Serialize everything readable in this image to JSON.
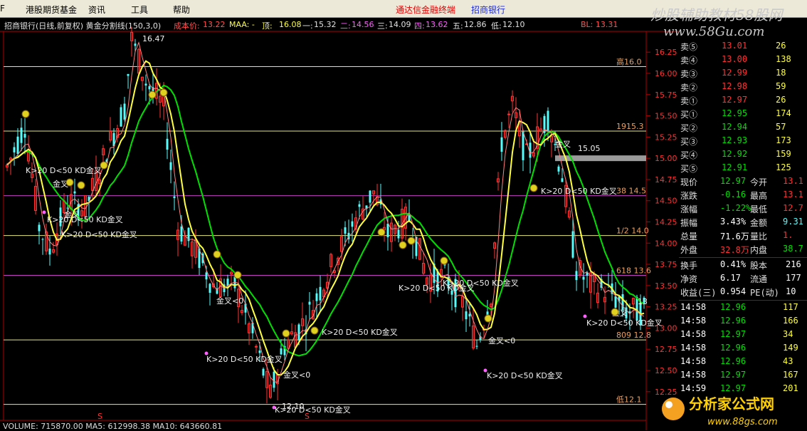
{
  "menu": {
    "items": [
      "F",
      "港股期货基金",
      "资讯",
      "工具",
      "帮助"
    ],
    "promo": "通达信金融终端",
    "stock_name": "招商银行"
  },
  "info": {
    "title": "招商银行(日线,前复权) 黄金分割线(150,3,0)",
    "cost_label": "成本价:",
    "cost_value": "13.22",
    "maa_label": "MAA: -",
    "top_label": "顶:",
    "top_value": "16.08",
    "l1_label": "一:",
    "l1_value": "15.32",
    "l2_label": "二:",
    "l2_value": "14.56",
    "l3_label": "三:",
    "l3_value": "14.09",
    "l4_label": "四:",
    "l4_value": "13.62",
    "l5_label": "五:",
    "l5_value": "12.86",
    "low_label": "低:",
    "low_value": "12.10",
    "bl": "BL: 13.31"
  },
  "watermark": {
    "top_line1": "炒股辅助教材58股网",
    "top_line2": "www.58Gu.com",
    "bottom_line1": "分析家公式网",
    "bottom_line2": "www.88gs.com"
  },
  "price_axis": [
    "16.25",
    "16.00",
    "15.75",
    "15.50",
    "15.25",
    "15.00",
    "14.75",
    "14.50",
    "14.25",
    "14.00",
    "13.75",
    "13.50",
    "13.25",
    "13.00",
    "12.75",
    "12.50",
    "12.25"
  ],
  "fib_labels": [
    "高16.0",
    "1915.3",
    "38 14.5",
    "1/2 14.0",
    "618 13.6",
    "809 12.8",
    "低12.1"
  ],
  "annotations": {
    "peak": "16.47",
    "trough": "12.10",
    "kd": "K>20 D<50 KD金叉",
    "cross": "金叉",
    "cross_lt": "金叉<0",
    "peak2": "15.05",
    "right_13": "13",
    "s1": "S",
    "s2": "S"
  },
  "quote": {
    "sell": [
      {
        "label": "卖⑤",
        "price": "13.01",
        "vol": "26"
      },
      {
        "label": "卖④",
        "price": "13.00",
        "vol": "138"
      },
      {
        "label": "卖③",
        "price": "12.99",
        "vol": "18"
      },
      {
        "label": "卖②",
        "price": "12.98",
        "vol": "59"
      },
      {
        "label": "卖①",
        "price": "12.97",
        "vol": "26"
      }
    ],
    "buy": [
      {
        "label": "买①",
        "price": "12.95",
        "vol": "174"
      },
      {
        "label": "买②",
        "price": "12.94",
        "vol": "57"
      },
      {
        "label": "买③",
        "price": "12.93",
        "vol": "173"
      },
      {
        "label": "买④",
        "price": "12.92",
        "vol": "159"
      },
      {
        "label": "买⑤",
        "price": "12.91",
        "vol": "125"
      }
    ],
    "stats": [
      {
        "k1": "现价",
        "v1": "12.97",
        "k2": "今开",
        "v2": "13.1"
      },
      {
        "k1": "涨跌",
        "v1": "-0.16",
        "k2": "最高",
        "v2": "13.1"
      },
      {
        "k1": "涨幅",
        "v1": "-1.22%",
        "k2": "最低",
        "v2": "12.7"
      },
      {
        "k1": "振幅",
        "v1": "3.43%",
        "k2": "金额",
        "v2": "9.31"
      },
      {
        "k1": "总量",
        "v1": "71.6万",
        "k2": "量比",
        "v2": "1."
      },
      {
        "k1": "外盘",
        "v1": "32.8万",
        "k2": "内盘",
        "v2": "38.7"
      }
    ],
    "stats2": [
      {
        "k1": "换手",
        "v1": "0.41%",
        "k2": "股本",
        "v2": "216"
      },
      {
        "k1": "净资",
        "v1": "6.17",
        "k2": "流通",
        "v2": "177"
      },
      {
        "k1": "收益(三)",
        "v1": "0.954",
        "k2": "PE(动)",
        "v2": "10"
      }
    ],
    "ticks": [
      {
        "t": "14:58",
        "p": "12.96",
        "v": "117"
      },
      {
        "t": "14:58",
        "p": "12.96",
        "v": "166"
      },
      {
        "t": "14:58",
        "p": "12.97",
        "v": "34"
      },
      {
        "t": "14:58",
        "p": "12.96",
        "v": "149"
      },
      {
        "t": "14:58",
        "p": "12.96",
        "v": "43"
      },
      {
        "t": "14:58",
        "p": "12.97",
        "v": "167"
      },
      {
        "t": "14:59",
        "p": "12.97",
        "v": "201"
      }
    ]
  },
  "volume": {
    "text": "VOLUME: 715870.00  MA5: 612998.38  MA10: 643660.81"
  },
  "colors": {
    "up": "#ff3232",
    "down": "#54fcfc",
    "ma_green": "#00e000",
    "ma_yellow": "#ffff40",
    "fib_yellow": "#e6e680",
    "fib_purple": "#c040c0",
    "price_red": "#ff3232",
    "price_green": "#00e000"
  }
}
